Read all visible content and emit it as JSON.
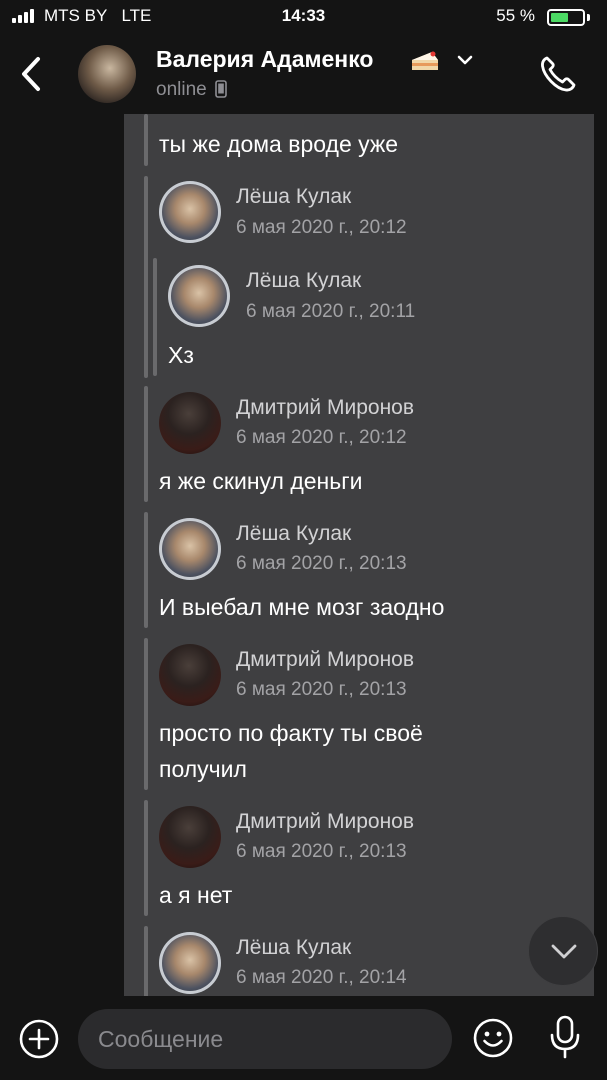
{
  "status_bar": {
    "carrier": "MTS BY",
    "network": "LTE",
    "time": "14:33",
    "battery_pct": "55 %",
    "battery_level": 0.55
  },
  "header": {
    "contact_name": "Валерия Адаменко",
    "presence": "online",
    "icons": [
      "back-icon",
      "cake-icon",
      "chevron-down-icon",
      "phone-icon"
    ]
  },
  "messages": [
    {
      "text": "ты же дома вроде уже"
    },
    {
      "author": "Лёша Кулак",
      "time": "6 мая 2020 г., 20:12",
      "nested": {
        "author": "Лёша Кулак",
        "time": "6 мая 2020 г., 20:11",
        "text": "Хз"
      }
    },
    {
      "author": "Дмитрий Миронов",
      "time": "6 мая 2020 г., 20:12",
      "text": "я же скинул деньги"
    },
    {
      "author": "Лёша Кулак",
      "time": "6 мая 2020 г., 20:13",
      "text": "И выебал мне мозг заодно"
    },
    {
      "author": "Дмитрий Миронов",
      "time": "6 мая 2020 г., 20:13",
      "text": "просто по факту ты своё получил"
    },
    {
      "author": "Дмитрий Миронов",
      "time": "6 мая 2020 г., 20:13",
      "text": "а я нет"
    },
    {
      "author": "Лёша Кулак",
      "time": "6 мая 2020 г., 20:14"
    }
  ],
  "composer": {
    "placeholder": "Сообщение",
    "icons": [
      "plus-icon",
      "smile-icon",
      "microphone-icon"
    ]
  },
  "colors": {
    "background": "#141414",
    "feed": "#3f3f41",
    "battery": "#4cd964",
    "muted_text": "#8e8e93"
  }
}
